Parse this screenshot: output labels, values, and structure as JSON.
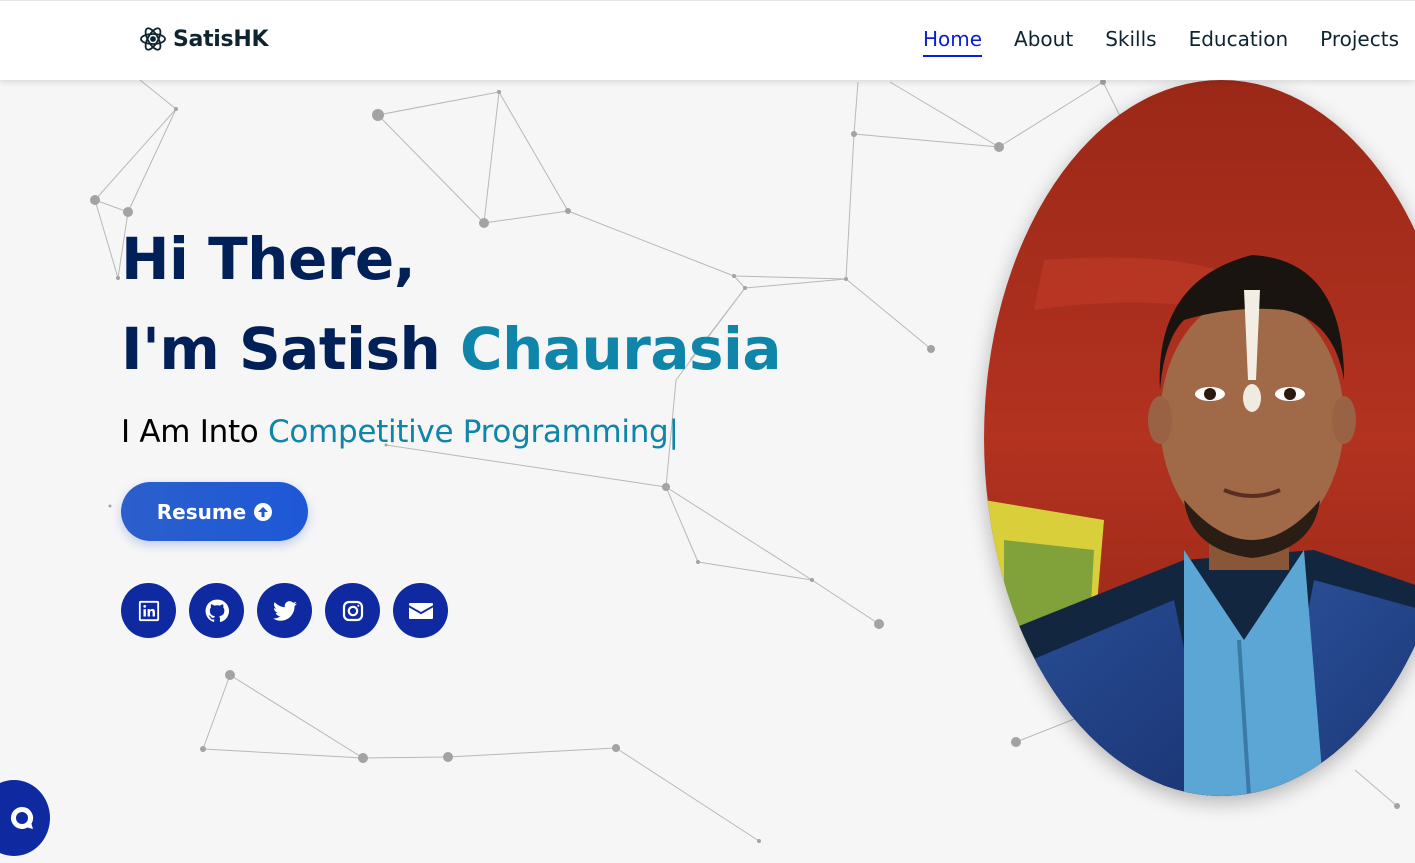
{
  "brand": {
    "name": "SatisHK",
    "icon": "atom-icon"
  },
  "nav": {
    "items": [
      {
        "label": "Home",
        "active": true
      },
      {
        "label": "About",
        "active": false
      },
      {
        "label": "Skills",
        "active": false
      },
      {
        "label": "Education",
        "active": false
      },
      {
        "label": "Projects",
        "active": false
      }
    ]
  },
  "hero": {
    "greeting": "Hi There,",
    "intro_prefix": "I'm Satish",
    "intro_highlight": "Chaurasia",
    "role_prefix": "I Am Into",
    "role_typed": "Competitive Programming",
    "cursor": "|",
    "resume_label": "Resume",
    "resume_icon": "arrow-up-circle-icon"
  },
  "socials": [
    {
      "name": "linkedin",
      "icon": "linkedin-icon"
    },
    {
      "name": "github",
      "icon": "github-icon"
    },
    {
      "name": "twitter",
      "icon": "twitter-icon"
    },
    {
      "name": "instagram",
      "icon": "instagram-icon"
    },
    {
      "name": "email",
      "icon": "envelope-icon"
    }
  ],
  "photo": {
    "alt": "portrait-photo"
  },
  "chat": {
    "icon": "chat-bubble-icon"
  },
  "colors": {
    "navy": "#002057",
    "accent": "#0e85a9",
    "nav_active": "#0a1fd1",
    "button": "#1d58d8",
    "social_bg": "#0f2aa0",
    "background": "#f6f6f7"
  }
}
